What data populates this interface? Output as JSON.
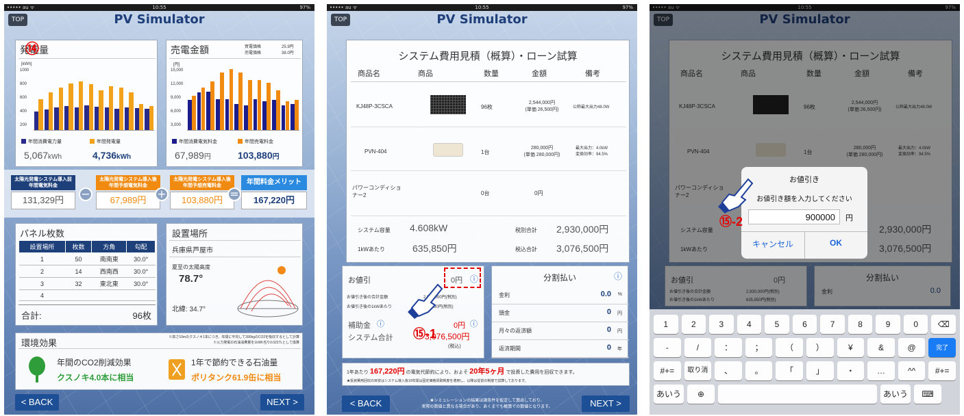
{
  "status": {
    "carrier": "••••• au ᯤ",
    "time": "10:55",
    "battery": "97%"
  },
  "app": {
    "top": "TOP",
    "title": "PV Simulator",
    "back": "< BACK",
    "next": "NEXT >"
  },
  "p1": {
    "marker": "⑭",
    "gen_title": "発電量",
    "gen_unit": "[kWh]",
    "gen_ticks": [
      "1000",
      "800",
      "600",
      "400",
      "200"
    ],
    "gen_leg1": "年間消費電力量",
    "gen_leg2": "年間発電量",
    "gen_val1": "5,067",
    "gen_val1u": "kWh",
    "gen_val2": "4,736",
    "gen_val2u": "kWh",
    "sale_title": "売電金額",
    "sale_buy_l": "買電価格",
    "sale_buy_v": "25.9円",
    "sale_sell_l": "売電価格",
    "sale_sell_v": "38.0円",
    "sale_unit": "[円]",
    "sale_ticks": [
      "15,000",
      "12,000",
      "9,000",
      "6,000",
      "3,000"
    ],
    "sale_leg1": "年間消費電気料金",
    "sale_leg2": "年間売電料金",
    "sale_val1": "67,989",
    "sale_val1u": "円",
    "sale_val2": "103,880",
    "sale_val2u": "円",
    "m1_label": "太陽光発電システム導入前\n年間電気料金",
    "m1_val": "131,329円",
    "m2_label": "太陽光発電システム導入後\n年間予想電気料金",
    "m2_val": "67,989円",
    "m3_label": "太陽光発電システム導入後\n年間予想売電料金",
    "m3_val": "103,880円",
    "m4_label": "年間料金メリット",
    "m4_val": "167,220円",
    "op1": "−",
    "op2": "+",
    "op3": "=",
    "panel_title": "パネル枚数",
    "panel_head": [
      "設置場所",
      "枚数",
      "方角",
      "勾配"
    ],
    "panel_rows": [
      [
        "1",
        "50",
        "南南東",
        "30.0°"
      ],
      [
        "2",
        "14",
        "西南西",
        "30.0°"
      ],
      [
        "3",
        "32",
        "東北東",
        "30.0°"
      ],
      [
        "4",
        "",
        "",
        ""
      ]
    ],
    "panel_total_l": "合計:",
    "panel_total_v": "96枚",
    "place_title": "設置場所",
    "place_val": "兵庫県芦屋市",
    "sun_l": "夏至の太陽高度",
    "sun_v": "78.7°",
    "lat": "北緯: 34.7°",
    "env_title": "環境効果",
    "env_note1": "※高さ10mのクスノキ1本につき、年間に平均して390kgのCO2を吸収するとして計算",
    "env_note2": "※火力発電の石油消費量を1kWh当り0.0227Lとして換算",
    "env_a1": "年間のCO2削減効果",
    "env_a2": "クスノキ4.0本に相当",
    "env_b1": "1年で節約できる石油量",
    "env_b2": "ポリタンク61.9缶に相当"
  },
  "p2": {
    "sys_title": "システム費用見積（概算）・ローン試算",
    "head": [
      "商品名",
      "商品",
      "数量",
      "金額",
      "備考"
    ],
    "rows": [
      {
        "name": "KJ48P-3CSCA",
        "qty": "96枚",
        "amt": "2,544,000円\n(単価 26,500円)",
        "note": "公称最大出力48.0W"
      },
      {
        "name": "PVN-404",
        "qty": "1台",
        "amt": "280,000円\n(単価 280,000円)",
        "note": "最大出力：4.0kW\n変換効率：94.5%"
      },
      {
        "name": "パワーコンディショ\nナー2",
        "qty": "0台",
        "amt": "0円",
        "note": ""
      }
    ],
    "cap_l": "システム容量",
    "cap_v": "4.608kW",
    "pre_l": "税別合計",
    "pre_v": "2,930,000円",
    "per_l": "1kWあたり",
    "per_v": "635,850円",
    "inc_l": "税込合計",
    "inc_v": "3,076,500円",
    "disc_l": "お値引",
    "disc_v": "0円",
    "disc_a_l": "お値引き後の合計金額",
    "disc_a_v": "2,930,000円(税別)",
    "disc_b_l": "お値引き後の1kWあたり",
    "disc_b_v": "635,850円(税別)",
    "sub_l": "補助金",
    "sub_v": "0円",
    "tot_l": "システム合計",
    "tot_v": "3,076,500円",
    "tot_tax": "(税込)",
    "inst_title": "分割払い",
    "inst": [
      [
        "金利",
        "0.0",
        "%"
      ],
      [
        "頭金",
        "0",
        "円"
      ],
      [
        "月々の返済額",
        "0",
        "円"
      ],
      [
        "返済期間",
        "0",
        "年"
      ]
    ],
    "foot1a": "1年あたり",
    "foot1b": "167,220円",
    "foot1c": "の電気代節約により、およそ",
    "foot1d": "20年5ヶ月",
    "foot1e": "で投資した費用を回収できます。",
    "foot2": "★投資費用回収の目安はシステム導入後10年間は固定価格買取制度を適用し、以降は従前の制度で試算しております。",
    "bottom_note": "★シミュレーションの結果は諸条件を仮定して算出しており、\n実際の数値と異なる場合があり、あくまでも概算での数値となります。",
    "marker": "⑮-1",
    "info": "ⓘ"
  },
  "p3": {
    "dlg_title": "お値引き",
    "dlg_msg": "お値引き額を入力してください",
    "dlg_val": "900000",
    "dlg_unit": "円",
    "dlg_cancel": "キャンセル",
    "dlg_ok": "OK",
    "marker": "⑮-2",
    "kb_row1": [
      "1",
      "2",
      "3",
      "4",
      "5",
      "6",
      "7",
      "8",
      "9",
      "0",
      "⌫"
    ],
    "kb_row2": [
      "-",
      "/",
      "：",
      "；",
      "（",
      "）",
      "¥",
      "&",
      "@",
      "完了"
    ],
    "kb_row3": [
      "#+=",
      "取り消す",
      "、",
      "。",
      "「",
      "」",
      "・",
      "…",
      "^^",
      "#+="
    ],
    "kb_row4": [
      "あいう",
      "⊕",
      "",
      "あいう",
      "⌨"
    ]
  }
}
